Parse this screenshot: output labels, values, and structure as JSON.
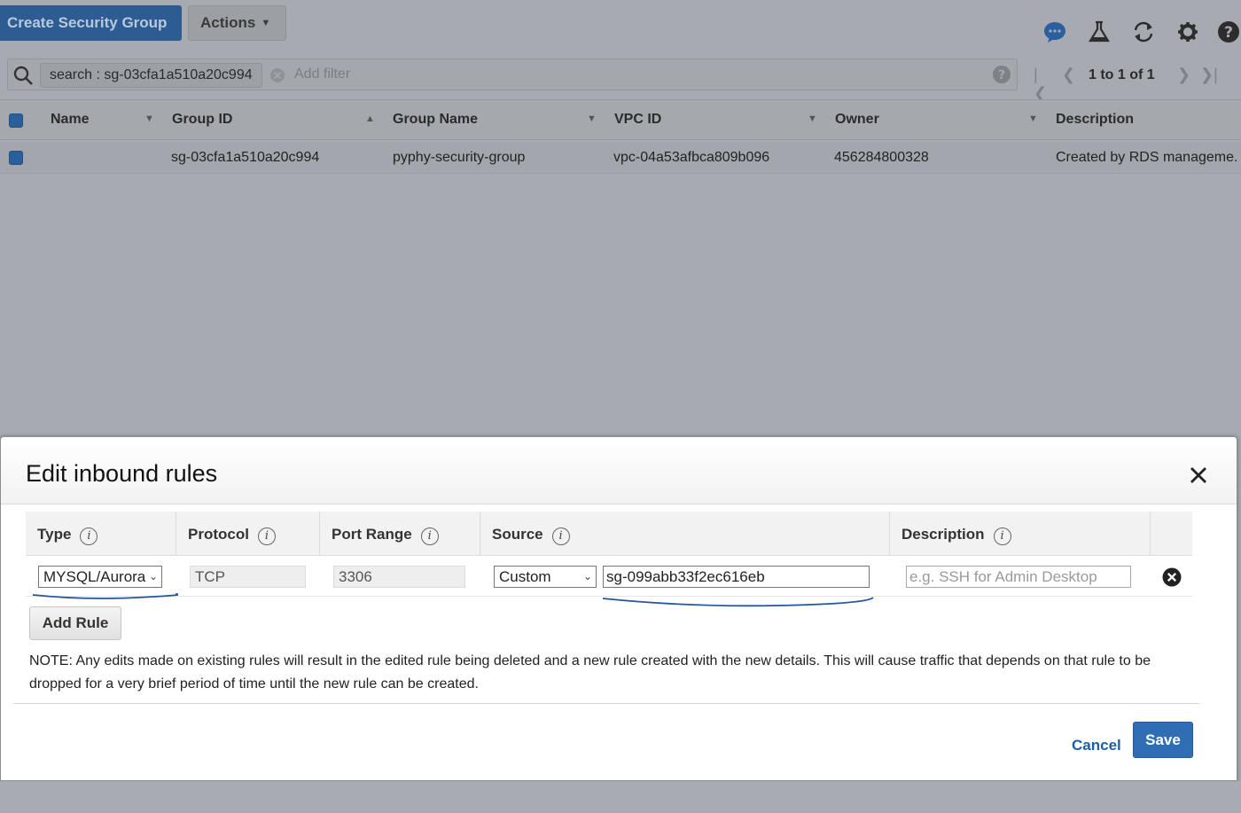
{
  "toolbar": {
    "create_label": "Create Security Group",
    "actions_label": "Actions",
    "icons": [
      "chat-icon",
      "flask-icon",
      "refresh-icon",
      "gear-icon",
      "help-icon"
    ]
  },
  "filter": {
    "token_key": "search",
    "token_value": "sg-03cfa1a510a20c994",
    "add_filter_placeholder": "Add filter"
  },
  "pager": {
    "text": "1 to 1 of 1"
  },
  "grid": {
    "columns": [
      "Name",
      "Group ID",
      "Group Name",
      "VPC ID",
      "Owner",
      "Description"
    ],
    "rows": [
      {
        "name": "",
        "group_id": "sg-03cfa1a510a20c994",
        "group_name": "pyphy-security-group",
        "vpc_id": "vpc-04a53afbca809b096",
        "owner": "456284800328",
        "description": "Created by RDS manageme."
      }
    ]
  },
  "modal": {
    "title": "Edit inbound rules",
    "columns": [
      "Type",
      "Protocol",
      "Port Range",
      "Source",
      "Description"
    ],
    "rule": {
      "type": "MYSQL/Aurora",
      "protocol": "TCP",
      "port_range": "3306",
      "source_type": "Custom",
      "source_value": "sg-099abb33f2ec616eb",
      "description_placeholder": "e.g. SSH for Admin Desktop"
    },
    "add_rule_label": "Add Rule",
    "note": "NOTE: Any edits made on existing rules will result in the edited rule being deleted and a new rule created with the new details. This will cause traffic that depends on that rule to be dropped for a very brief period of time until the new rule can be created.",
    "cancel_label": "Cancel",
    "save_label": "Save"
  },
  "colors": {
    "primary_button": "#2f6db5",
    "link": "#1d5fa5",
    "annotation_ink": "#2455a4"
  }
}
